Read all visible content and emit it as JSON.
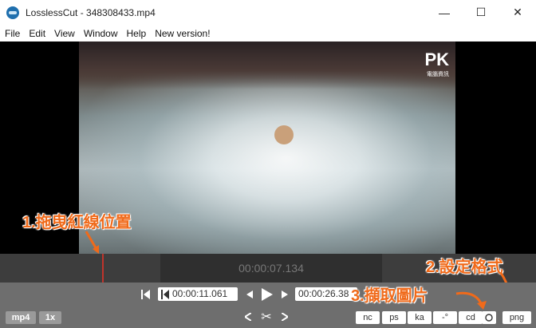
{
  "window": {
    "title": "LosslessCut - 348308433.mp4",
    "minimize": "—",
    "maximize": "☐",
    "close": "✕"
  },
  "menu": [
    "File",
    "Edit",
    "View",
    "Window",
    "Help",
    "New version!"
  ],
  "video": {
    "logo": "PK",
    "logo_sub": "電腦資訊"
  },
  "annotations": {
    "drag": "1.拖曳紅線位置",
    "format": "2.設定格式",
    "capture": "3.擷取圖片"
  },
  "timeline": {
    "segment_time": "00:00:07.134",
    "cursor_progress": 0.19
  },
  "controls": {
    "start_time": "00:00:11.061",
    "end_time": "00:00:26.38",
    "format_badge": "mp4",
    "speed_badge": "1x",
    "chips": [
      "nc",
      "ps",
      "ka",
      "-°",
      "cd",
      "png"
    ]
  },
  "colors": {
    "accent": "#f06a1a",
    "cursor": "#c0342b"
  }
}
